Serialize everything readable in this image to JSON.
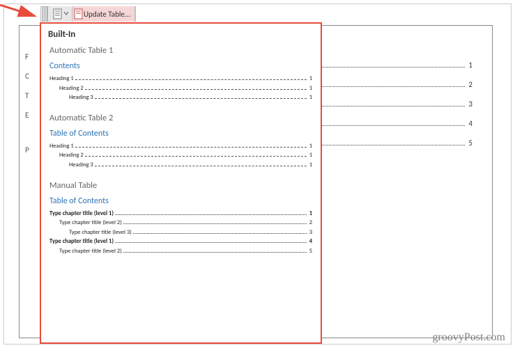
{
  "toolbar": {
    "update_label": "Update Table..."
  },
  "doc": {
    "side_letters": [
      "F",
      "C",
      "T",
      "E",
      "",
      "P"
    ],
    "lines": [
      {
        "pg": "1"
      },
      {
        "pg": "2"
      },
      {
        "pg": "3"
      },
      {
        "pg": "4"
      },
      {
        "pg": "5"
      }
    ]
  },
  "dropdown": {
    "header": "Built-In",
    "auto1": {
      "title": "Automatic Table 1",
      "subtitle": "Contents",
      "rows": [
        {
          "txt": "Heading 1",
          "num": "1",
          "ind": 0
        },
        {
          "txt": "Heading 2",
          "num": "1",
          "ind": 1
        },
        {
          "txt": "Heading 3",
          "num": "1",
          "ind": 2
        }
      ]
    },
    "auto2": {
      "title": "Automatic Table 2",
      "subtitle": "Table of Contents",
      "rows": [
        {
          "txt": "Heading 1",
          "num": "1",
          "ind": 0
        },
        {
          "txt": "Heading 2",
          "num": "1",
          "ind": 1
        },
        {
          "txt": "Heading 3",
          "num": "1",
          "ind": 2
        }
      ]
    },
    "manual": {
      "title": "Manual Table",
      "subtitle": "Table of Contents",
      "rows": [
        {
          "txt": "Type chapter title (level 1)",
          "num": "1",
          "ind": 0,
          "bold": true
        },
        {
          "txt": "Type chapter title (level 2)",
          "num": "2",
          "ind": 1
        },
        {
          "txt": "Type chapter title (level 3)",
          "num": "3",
          "ind": 2
        },
        {
          "txt": "Type chapter title (level 1)",
          "num": "4",
          "ind": 0,
          "bold": true
        },
        {
          "txt": "Type chapter title (level 2)",
          "num": "5",
          "ind": 1
        }
      ]
    }
  },
  "watermark": "groovyPost.com"
}
